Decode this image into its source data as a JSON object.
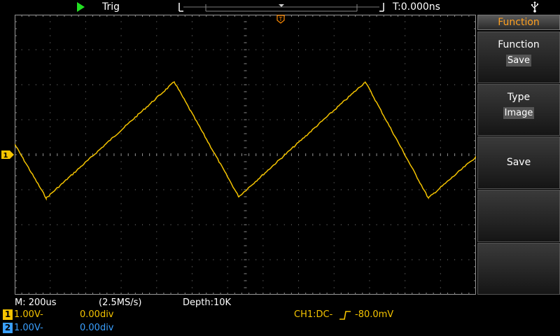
{
  "topbar": {
    "trigger_status": "Trig",
    "time_offset": "T:0.000ns"
  },
  "menu": {
    "header": "Function",
    "items": [
      {
        "label": "Function",
        "value": "Save"
      },
      {
        "label": "Type",
        "value": "Image"
      },
      {
        "label": "Save",
        "value": ""
      },
      {
        "label": "",
        "value": ""
      },
      {
        "label": "",
        "value": ""
      }
    ]
  },
  "status": {
    "timebase": "M: 200us",
    "sample_rate": "(2.5MS/s)",
    "depth": "Depth:10K",
    "ch1_num": "1",
    "ch1_volts": "1.00V-",
    "ch1_pos": "0.00div",
    "ch2_num": "2",
    "ch2_volts": "1.00V-",
    "ch2_pos": "0.00div",
    "trigger_info": "CH1:DC-",
    "trigger_level": "-80.0mV"
  },
  "colors": {
    "ch1": "#f5c400",
    "ch2": "#3aa0ff",
    "trigger": "#ff8a00",
    "grid": "#8a8a8a",
    "menu_header": "#ffa020"
  },
  "waveform": {
    "channel": "CH1",
    "shape": "triangle (sawtooth)"
  }
}
